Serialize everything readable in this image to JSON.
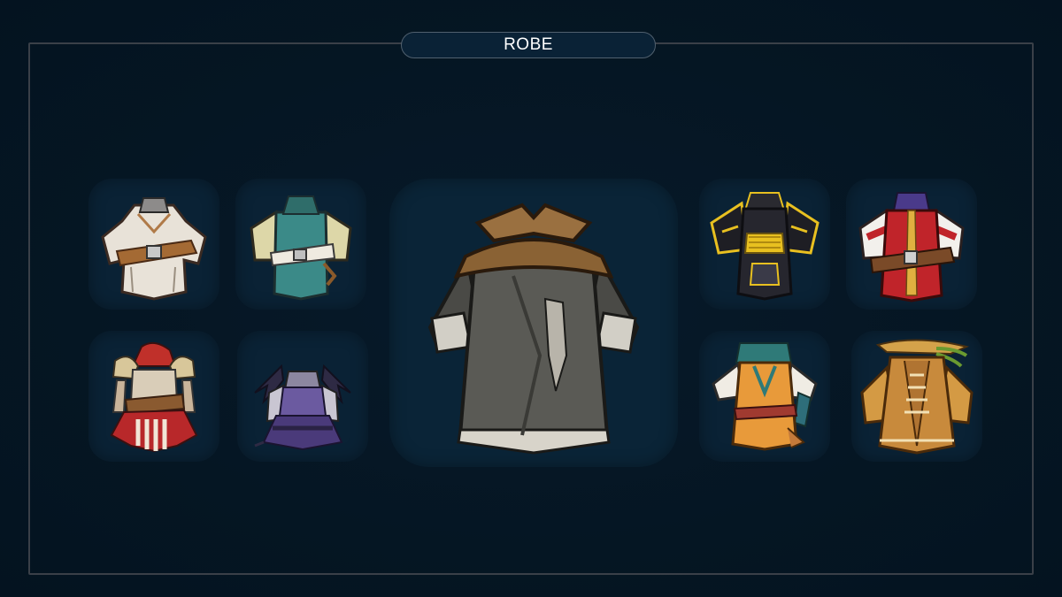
{
  "screen": {
    "title": "ROBE",
    "colors": {
      "background": "#051623",
      "frame_border": "#3a4048",
      "slot_background": "#0a2235",
      "title_text": "#ffffff"
    }
  },
  "robes": {
    "featured": {
      "icon": "dark-grey-robe-with-brown-cape-icon"
    },
    "left_grid": [
      {
        "icon": "white-robe-with-brown-belt-icon"
      },
      {
        "icon": "teal-robe-with-cream-sleeves-icon"
      },
      {
        "icon": "red-hood-armor-with-gold-pauldrons-icon"
      },
      {
        "icon": "purple-demon-wing-robe-icon"
      }
    ],
    "right_grid": [
      {
        "icon": "black-gold-samurai-armor-icon"
      },
      {
        "icon": "red-white-knight-robe-icon"
      },
      {
        "icon": "orange-adventurer-outfit-icon"
      },
      {
        "icon": "tan-druid-robe-with-hat-icon"
      }
    ]
  }
}
